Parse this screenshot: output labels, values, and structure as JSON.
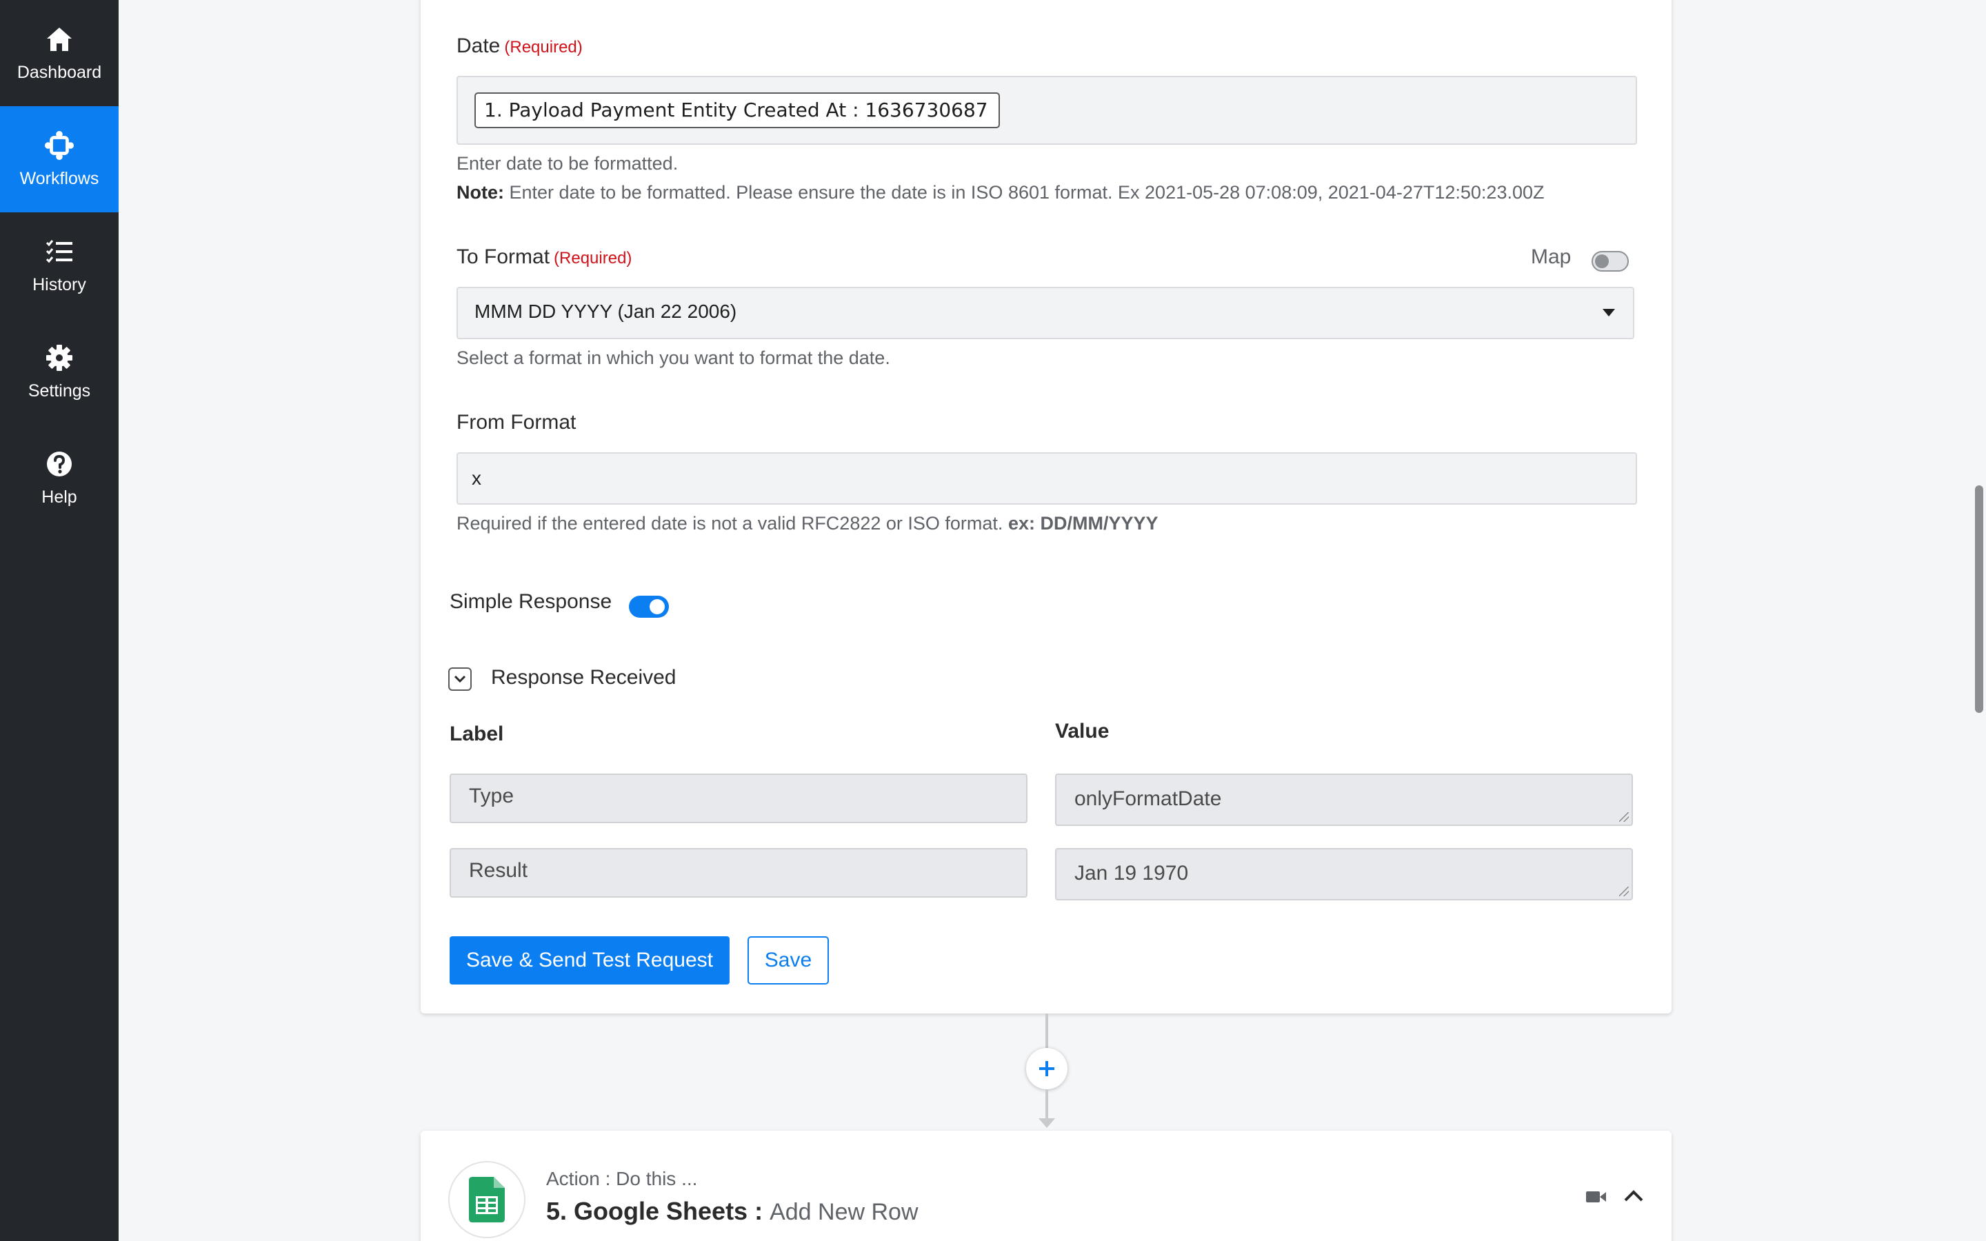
{
  "sidebar": {
    "items": [
      {
        "label": "Dashboard",
        "icon": "home-icon"
      },
      {
        "label": "Workflows",
        "icon": "workflow-icon",
        "active": true
      },
      {
        "label": "History",
        "icon": "history-list-icon"
      },
      {
        "label": "Settings",
        "icon": "gear-icon"
      },
      {
        "label": "Help",
        "icon": "help-circle-icon"
      }
    ]
  },
  "form": {
    "date": {
      "label": "Date",
      "required": "(Required)",
      "chip": "1. Payload Payment Entity Created At : 1636730687",
      "help": "Enter date to be formatted.",
      "note_label": "Note:",
      "note": "Enter date to be formatted. Please ensure the date is in ISO 8601 format. Ex 2021-05-28 07:08:09, 2021-04-27T12:50:23.00Z"
    },
    "to_format": {
      "label": "To Format",
      "required": "(Required)",
      "map_label": "Map",
      "map_on": false,
      "selected": "MMM DD YYYY (Jan 22 2006)",
      "help": "Select a format in which you want to format the date."
    },
    "from_format": {
      "label": "From Format",
      "value": "x",
      "help": "Required if the entered date is not a valid RFC2822 or ISO format.",
      "help_example": "ex: DD/MM/YYYY"
    },
    "simple_response": {
      "label": "Simple Response",
      "on": true
    },
    "response_received": {
      "label": "Response Received",
      "label_header": "Label",
      "value_header": "Value",
      "rows": [
        {
          "label": "Type",
          "value": "onlyFormatDate"
        },
        {
          "label": "Result",
          "value": "Jan 19 1970"
        }
      ]
    },
    "buttons": {
      "save_send": "Save & Send Test Request",
      "save": "Save"
    }
  },
  "next_action": {
    "subtitle": "Action : Do this ...",
    "title": "5. Google Sheets :",
    "event": "Add New Row",
    "app_icon": "google-sheets-icon"
  },
  "colors": {
    "sidebar_bg": "#24282c",
    "accent": "#0b7ff1",
    "required": "#d0121a",
    "sheets_green": "#21a464"
  }
}
